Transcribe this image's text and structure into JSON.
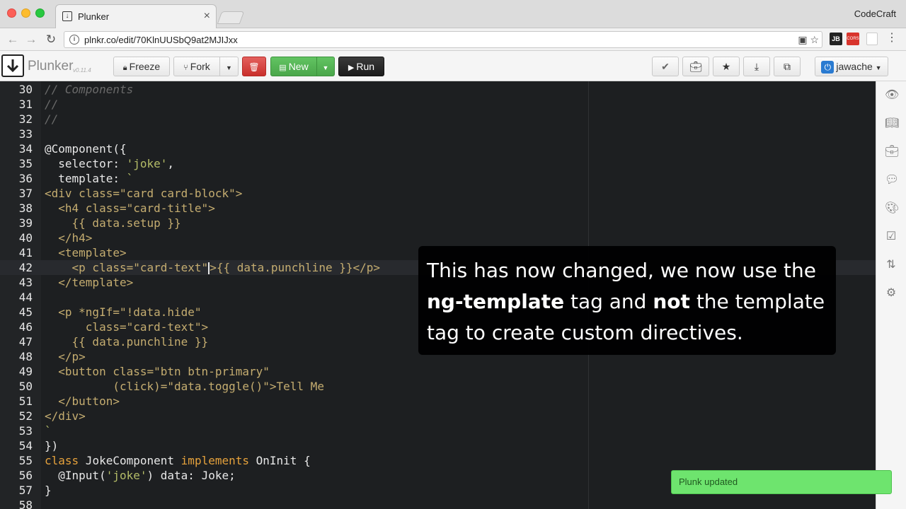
{
  "browser": {
    "tab_title": "Plunker",
    "tab_close": "×",
    "profile": "CodeCraft",
    "url": "plnkr.co/edit/70KlnUUSbQ9at2MJIJxx",
    "ext_jb": "JB",
    "ext_cors": "CORS"
  },
  "toolbar": {
    "logo": "Plunker",
    "version": "v0.11.4",
    "freeze": "Freeze",
    "fork": "Fork",
    "new": "New",
    "run": "Run",
    "user": "jawache"
  },
  "editor": {
    "lines": [
      {
        "n": "30",
        "tokens": [
          [
            "comment",
            "// Components"
          ]
        ]
      },
      {
        "n": "31",
        "tokens": [
          [
            "comment",
            "//"
          ]
        ]
      },
      {
        "n": "32",
        "tokens": [
          [
            "comment",
            "//"
          ]
        ]
      },
      {
        "n": "33",
        "tokens": []
      },
      {
        "n": "34",
        "tokens": [
          [
            "text",
            "@Component({"
          ]
        ]
      },
      {
        "n": "35",
        "tokens": [
          [
            "text",
            "  selector: "
          ],
          [
            "str",
            "'joke'"
          ],
          [
            "text",
            ","
          ]
        ]
      },
      {
        "n": "36",
        "tokens": [
          [
            "text",
            "  template: "
          ],
          [
            "str",
            "`"
          ]
        ]
      },
      {
        "n": "37",
        "tokens": [
          [
            "tag",
            "<div class=\"card card-block\">"
          ]
        ]
      },
      {
        "n": "38",
        "tokens": [
          [
            "tag",
            "  <h4 class=\"card-title\">"
          ]
        ]
      },
      {
        "n": "39",
        "tokens": [
          [
            "tag",
            "    {{ data.setup }}"
          ]
        ]
      },
      {
        "n": "40",
        "tokens": [
          [
            "tag",
            "  </h4>"
          ]
        ]
      },
      {
        "n": "41",
        "tokens": [
          [
            "tag",
            "  <template>"
          ]
        ]
      },
      {
        "n": "42",
        "tokens": [
          [
            "tag",
            "    <p class=\"card-text\""
          ],
          [
            "cursor",
            ""
          ],
          [
            "tag",
            ">{{ data.punchline }}</p>"
          ]
        ],
        "active": true
      },
      {
        "n": "43",
        "tokens": [
          [
            "tag",
            "  </template>"
          ]
        ]
      },
      {
        "n": "44",
        "tokens": []
      },
      {
        "n": "45",
        "tokens": [
          [
            "tag",
            "  <p *ngIf=\"!data.hide\""
          ]
        ]
      },
      {
        "n": "46",
        "tokens": [
          [
            "tag",
            "      class=\"card-text\">"
          ]
        ]
      },
      {
        "n": "47",
        "tokens": [
          [
            "tag",
            "    {{ data.punchline }}"
          ]
        ]
      },
      {
        "n": "48",
        "tokens": [
          [
            "tag",
            "  </p>"
          ]
        ]
      },
      {
        "n": "49",
        "tokens": [
          [
            "tag",
            "  <button class=\"btn btn-primary\""
          ]
        ]
      },
      {
        "n": "50",
        "tokens": [
          [
            "tag",
            "          (click)=\"data.toggle()\">Tell Me"
          ]
        ]
      },
      {
        "n": "51",
        "tokens": [
          [
            "tag",
            "  </button>"
          ]
        ]
      },
      {
        "n": "52",
        "tokens": [
          [
            "tag",
            "</div>"
          ]
        ]
      },
      {
        "n": "53",
        "tokens": [
          [
            "str",
            "`"
          ]
        ]
      },
      {
        "n": "54",
        "tokens": [
          [
            "text",
            "})"
          ]
        ]
      },
      {
        "n": "55",
        "tokens": [
          [
            "kw",
            "class"
          ],
          [
            "text",
            " JokeComponent "
          ],
          [
            "kw",
            "implements"
          ],
          [
            "text",
            " OnInit {"
          ]
        ]
      },
      {
        "n": "56",
        "tokens": [
          [
            "text",
            "  @Input("
          ],
          [
            "str",
            "'joke'"
          ],
          [
            "text",
            ") data: Joke;"
          ]
        ]
      },
      {
        "n": "57",
        "tokens": [
          [
            "text",
            "}"
          ]
        ]
      },
      {
        "n": "58",
        "tokens": []
      }
    ]
  },
  "caption": {
    "part1": "This has now changed, we now use the ",
    "bold1": "ng-template",
    "part2": " tag and ",
    "bold2": "not",
    "part3": " the template tag to create custom directives."
  },
  "toast": "Plunk updated"
}
